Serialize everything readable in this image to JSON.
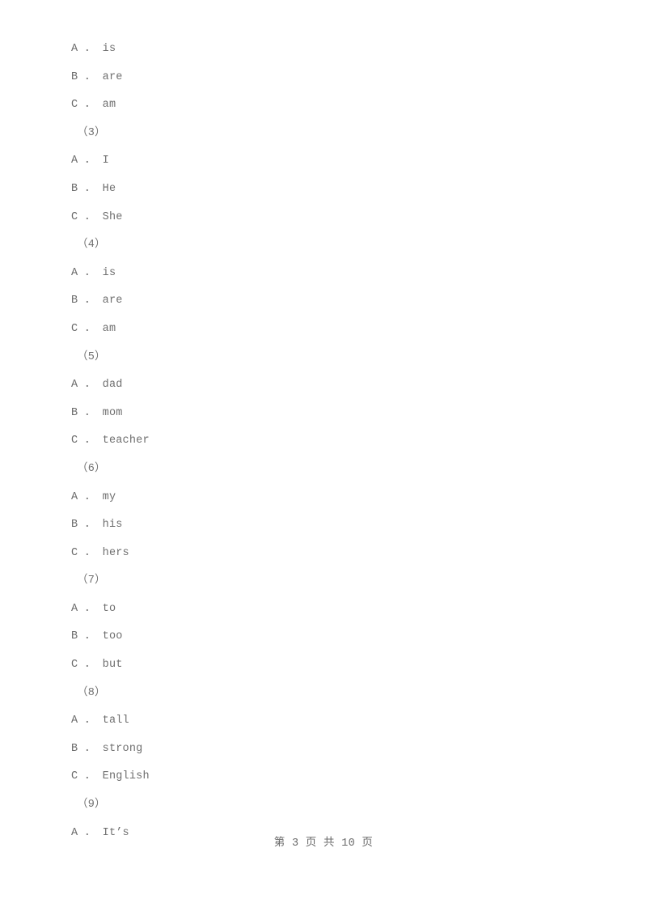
{
  "document": {
    "page_background": "#ffffff",
    "text_color": "#6c6c6c"
  },
  "body": {
    "lines": [
      {
        "kind": "option",
        "letter": "A",
        "separator": "．",
        "text": "is"
      },
      {
        "kind": "option",
        "letter": "B",
        "separator": "．",
        "text": "are"
      },
      {
        "kind": "option",
        "letter": "C",
        "separator": "．",
        "text": "am"
      },
      {
        "kind": "question_number",
        "label": "（3）"
      },
      {
        "kind": "option",
        "letter": "A",
        "separator": "．",
        "text": "I"
      },
      {
        "kind": "option",
        "letter": "B",
        "separator": "．",
        "text": "He"
      },
      {
        "kind": "option",
        "letter": "C",
        "separator": "．",
        "text": "She"
      },
      {
        "kind": "question_number",
        "label": "（4）"
      },
      {
        "kind": "option",
        "letter": "A",
        "separator": "．",
        "text": "is"
      },
      {
        "kind": "option",
        "letter": "B",
        "separator": "．",
        "text": "are"
      },
      {
        "kind": "option",
        "letter": "C",
        "separator": "．",
        "text": "am"
      },
      {
        "kind": "question_number",
        "label": "（5）"
      },
      {
        "kind": "option",
        "letter": "A",
        "separator": "．",
        "text": "dad"
      },
      {
        "kind": "option",
        "letter": "B",
        "separator": "．",
        "text": "mom"
      },
      {
        "kind": "option",
        "letter": "C",
        "separator": "．",
        "text": "teacher"
      },
      {
        "kind": "question_number",
        "label": "（6）"
      },
      {
        "kind": "option",
        "letter": "A",
        "separator": "．",
        "text": "my"
      },
      {
        "kind": "option",
        "letter": "B",
        "separator": "．",
        "text": "his"
      },
      {
        "kind": "option",
        "letter": "C",
        "separator": "．",
        "text": "hers"
      },
      {
        "kind": "question_number",
        "label": "（7）"
      },
      {
        "kind": "option",
        "letter": "A",
        "separator": "．",
        "text": "to"
      },
      {
        "kind": "option",
        "letter": "B",
        "separator": "．",
        "text": "too"
      },
      {
        "kind": "option",
        "letter": "C",
        "separator": "．",
        "text": "but"
      },
      {
        "kind": "question_number",
        "label": "（8）"
      },
      {
        "kind": "option",
        "letter": "A",
        "separator": "．",
        "text": "tall"
      },
      {
        "kind": "option",
        "letter": "B",
        "separator": "．",
        "text": "strong"
      },
      {
        "kind": "option",
        "letter": "C",
        "separator": "．",
        "text": "English"
      },
      {
        "kind": "question_number",
        "label": "（9）"
      },
      {
        "kind": "option",
        "letter": "A",
        "separator": "．",
        "text": "It’s"
      }
    ]
  },
  "footer": {
    "text": "第 3 页 共 10 页",
    "current_page": "3",
    "total_pages": "10"
  }
}
